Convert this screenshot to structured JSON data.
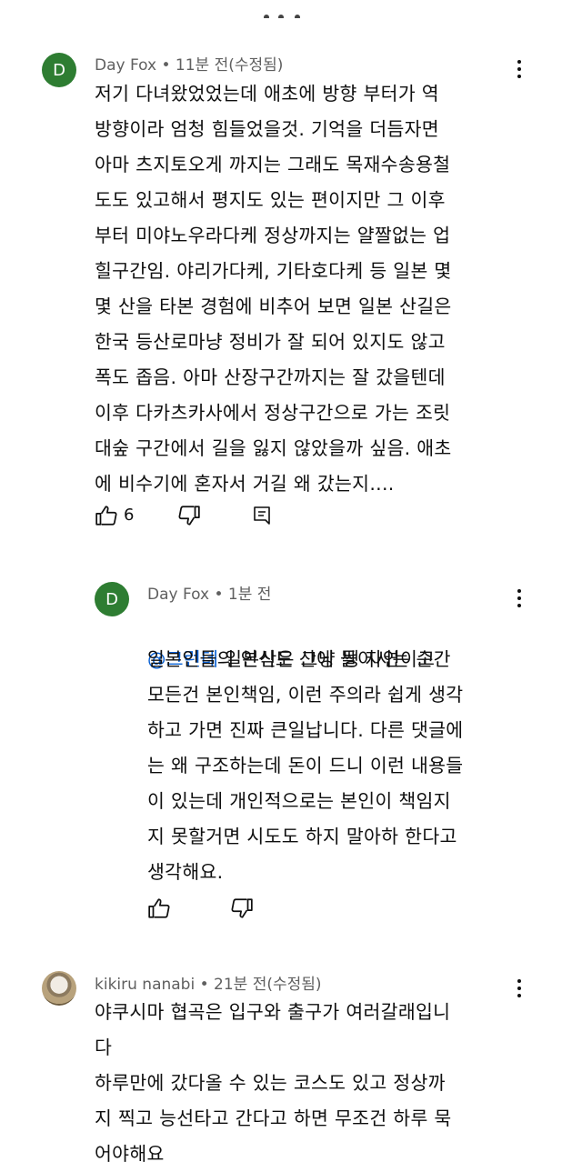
{
  "comments": [
    {
      "avatar_letter": "D",
      "meta": "Day Fox • 11분 전(수정됨)",
      "text": "저기 다녀왔었었는데 애초에 방향 부터가 역\n방향이라 엄청 힘들었을것. 기억을 더듬자면\n아마 츠지토오게 까지는 그래도 목재수송용철\n도도 있고해서 평지도 있는 편이지만 그 이후\n부터 미야노우라다케 정상까지는 얄짤없는 업\n힐구간임. 야리가다케, 기타호다케 등 일본 몇\n몇 산을 타본 경험에 비추어 보면 일본 산길은\n한국 등산로마냥 정비가 잘 되어 있지도 않고\n폭도 좁음. 아마 산장구간까지는 잘 갔을텐데\n이후 다카츠카사에서 정상구간으로 가는 조릿\n대숲 구간에서 길을 잃지 않았을까 싶음. 애초\n에 비수기에 혼자서 거길 왜 갔는지....",
      "like_count": "6"
    },
    {
      "avatar_letter": "D",
      "meta": "Day Fox • 1분 전",
      "mention": "@그런데",
      "text_first": "  일본산은 그냥 쌩 자연이고",
      "text": "일본인들의 인식도 산에 들어서는 순간\n모든건 본인책임, 이런 주의라 쉽게 생각\n하고 가면 진짜 큰일납니다. 다른 댓글에\n는 왜 구조하는데 돈이 드니 이런 내용들\n이 있는데 개인적으로는 본인이 책임지\n지 못할거면 시도도 하지 말아하 한다고\n생각해요."
    },
    {
      "meta": "kikiru nanabi • 21분 전(수정됨)",
      "text": "야쿠시마 협곡은 입구와 출구가 여러갈래입니\n다\n하루만에 갔다올 수 있는 코스도 있고 정상까\n지 찍고 능선타고 간다고 하면 무조건 하루 묵\n어야해요"
    }
  ],
  "colors": {
    "avatar_bg": "#2e7d32",
    "meta_text": "#606060",
    "mention": "#065fd4"
  },
  "icons": [
    "like-icon",
    "dislike-icon",
    "reply-icon",
    "more-vert-icon"
  ]
}
